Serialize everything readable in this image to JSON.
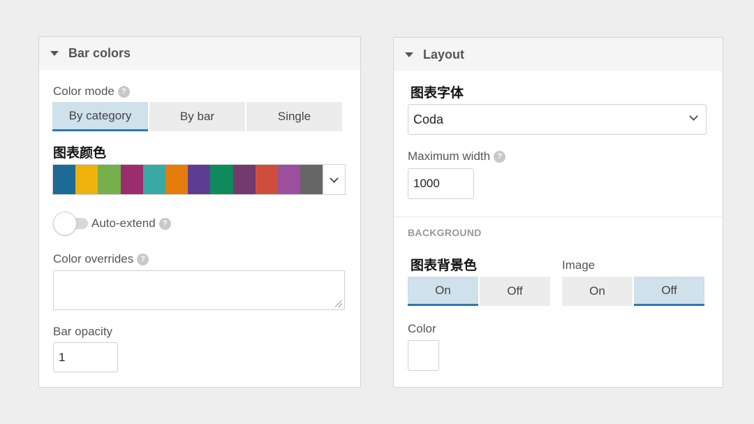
{
  "bar_colors": {
    "title": "Bar colors",
    "color_mode_label": "Color mode",
    "color_mode_options": [
      "By category",
      "By bar",
      "Single"
    ],
    "color_mode_selected": "By category",
    "palette_label": "图表颜色",
    "palette": [
      "#1d6a96",
      "#efb20c",
      "#75b04b",
      "#9b2d6f",
      "#3aa9a4",
      "#e57d0c",
      "#5d3d94",
      "#0f8a5d",
      "#733a6e",
      "#cf4d3d",
      "#9b4f9c",
      "#666666"
    ],
    "auto_extend_label": "Auto-extend",
    "auto_extend_on": false,
    "color_overrides_label": "Color overrides",
    "color_overrides_value": "",
    "bar_opacity_label": "Bar opacity",
    "bar_opacity_value": "1"
  },
  "layout": {
    "title": "Layout",
    "font_label": "图表字体",
    "font_value": "Coda",
    "max_width_label": "Maximum width",
    "max_width_value": "1000",
    "background_heading": "BACKGROUND",
    "bg_color_label": "图表背景色",
    "bg_color_options": [
      "On",
      "Off"
    ],
    "bg_color_selected": "On",
    "image_label": "Image",
    "image_options": [
      "On",
      "Off"
    ],
    "image_selected": "Off",
    "color_label": "Color",
    "color_value": "#ffffff"
  },
  "help_glyph": "?"
}
